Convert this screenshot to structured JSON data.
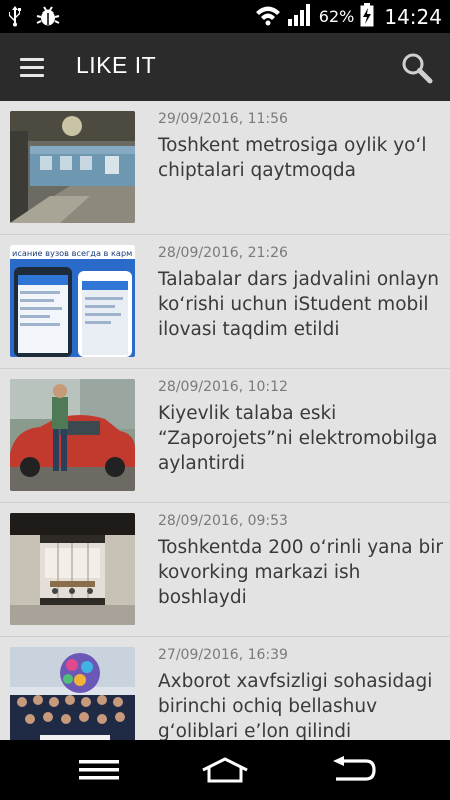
{
  "status_bar": {
    "battery_percent": "62%",
    "time": "14:24",
    "icons": [
      "usb-icon",
      "bug-icon",
      "wifi-icon",
      "signal-icon",
      "battery-charging-icon"
    ]
  },
  "app_bar": {
    "title": "LIKE IT",
    "menu_icon": "hamburger-menu-icon",
    "search_icon": "search-icon"
  },
  "articles": [
    {
      "date": "29/09/2016, 11:56",
      "headline": "Toshkent metrosiga oylik yo‘l chiptalari qaytmoqda",
      "thumbnail": "metro-train-photo"
    },
    {
      "date": "28/09/2016, 21:26",
      "headline": "Talabalar dars jadvalini onlayn ko‘rishi uchun iStudent mobil ilovasi taqdim etildi",
      "thumbnail": "istudent-app-screens-photo",
      "thumbnail_text": "исание вузов всегда в карм"
    },
    {
      "date": "28/09/2016, 10:12",
      "headline": "Kiyevlik talaba eski “Zaporojets”ni elektromobilga aylantirdi",
      "thumbnail": "red-car-student-photo"
    },
    {
      "date": "28/09/2016, 09:53",
      "headline": "Toshkentda 200 o‘rinli yana bir kovorking markazi ish boshlaydi",
      "thumbnail": "coworking-office-photo"
    },
    {
      "date": "27/09/2016, 16:39",
      "headline": "Axborot xavfsizligi sohasidagi birinchi ochiq bellashuv g‘oliblari e’lon qilindi",
      "thumbnail": "group-photo-globe"
    }
  ],
  "nav_bar": {
    "icons": [
      "recent-apps-icon",
      "home-icon",
      "back-icon"
    ]
  }
}
